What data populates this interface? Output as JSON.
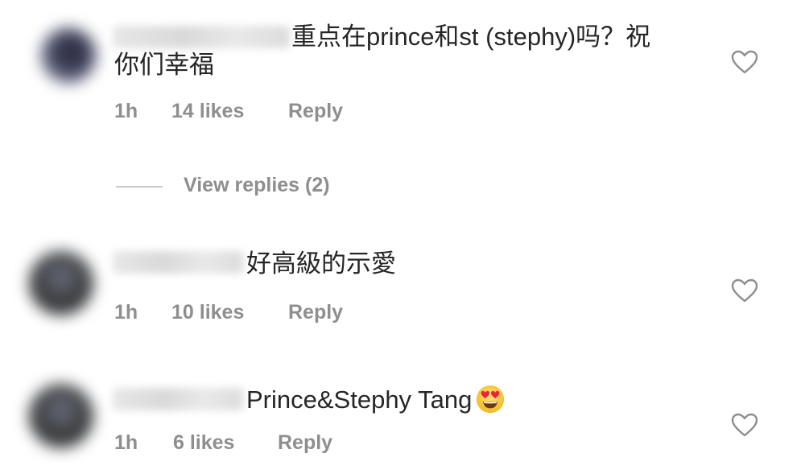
{
  "comments": [
    {
      "text_line1": "重点在prince和st (stephy)吗？祝",
      "text_line2": "你们幸福",
      "time": "1h",
      "likes": "14 likes",
      "reply": "Reply",
      "heart_icon": "heart-outline-icon"
    },
    {
      "text": "好高級的示愛",
      "time": "1h",
      "likes": "10 likes",
      "reply": "Reply",
      "heart_icon": "heart-outline-icon"
    },
    {
      "text": "Prince&Stephy Tang",
      "emoji": "heart-eyes-emoji-icon",
      "time": "1h",
      "likes": "6 likes",
      "reply": "Reply",
      "heart_icon": "heart-outline-icon"
    }
  ],
  "view_replies": "View replies (2)",
  "colors": {
    "text": "#262626",
    "meta": "#8e8e8e",
    "divider": "#c7c7c7"
  }
}
